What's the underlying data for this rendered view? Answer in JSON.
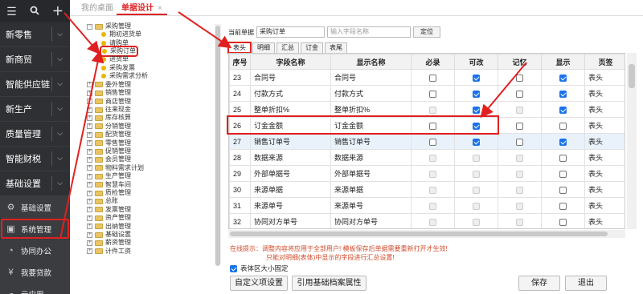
{
  "sidebar": {
    "top_icons": [
      "menu-icon",
      "search-icon",
      "plus-icon"
    ],
    "main_items": [
      {
        "label": "新零售"
      },
      {
        "label": "新商贸"
      },
      {
        "label": "智能供应链"
      },
      {
        "label": "新生产"
      },
      {
        "label": "质量管理"
      },
      {
        "label": "智能财税"
      },
      {
        "label": "基础设置"
      }
    ],
    "sub_items": [
      {
        "label": "基础设置",
        "icon": "gear-icon"
      },
      {
        "label": "系统管理",
        "icon": "monitor-icon"
      },
      {
        "label": "协同办公",
        "icon": "chat-icon"
      },
      {
        "label": "我要贷款",
        "icon": "money-icon"
      },
      {
        "label": "云应用",
        "icon": "cloud-icon"
      }
    ]
  },
  "tabs": {
    "desk": "我的桌面",
    "design": "单据设计",
    "close": "×"
  },
  "tree": {
    "items": [
      {
        "label": "采购管理",
        "kind": "folder"
      },
      {
        "label": "期初进货单",
        "kind": "leaf"
      },
      {
        "label": "请购单",
        "kind": "leaf"
      },
      {
        "label": "采购订单",
        "kind": "leaf"
      },
      {
        "label": "进货单",
        "kind": "leaf"
      },
      {
        "label": "采购发票",
        "kind": "leaf"
      },
      {
        "label": "采购需求分析",
        "kind": "leaf"
      },
      {
        "label": "委外管理",
        "kind": "folder"
      },
      {
        "label": "销售管理",
        "kind": "folder"
      },
      {
        "label": "商店管理",
        "kind": "folder"
      },
      {
        "label": "往来现金",
        "kind": "folder"
      },
      {
        "label": "库存核算",
        "kind": "folder"
      },
      {
        "label": "分销管理",
        "kind": "folder"
      },
      {
        "label": "配货管理",
        "kind": "folder"
      },
      {
        "label": "零售管理",
        "kind": "folder"
      },
      {
        "label": "促销管理",
        "kind": "folder"
      },
      {
        "label": "会员管理",
        "kind": "folder"
      },
      {
        "label": "物料需求计划",
        "kind": "folder"
      },
      {
        "label": "生产管理",
        "kind": "folder"
      },
      {
        "label": "智慧车间",
        "kind": "folder"
      },
      {
        "label": "质检管理",
        "kind": "folder"
      },
      {
        "label": "总账",
        "kind": "folder"
      },
      {
        "label": "发票管理",
        "kind": "folder"
      },
      {
        "label": "资产管理",
        "kind": "folder"
      },
      {
        "label": "出纳管理",
        "kind": "folder"
      },
      {
        "label": "基础设置",
        "kind": "folder"
      },
      {
        "label": "薪资管理",
        "kind": "folder"
      },
      {
        "label": "计件工资",
        "kind": "folder"
      }
    ]
  },
  "form": {
    "current_label": "当前单据",
    "current_value": "采购订单",
    "field_placeholder": "输入字段名称",
    "locate_label": "定位"
  },
  "subtabs": [
    {
      "label": "表头"
    },
    {
      "label": "明细"
    },
    {
      "label": "汇总"
    },
    {
      "label": "订金"
    },
    {
      "label": "表尾"
    }
  ],
  "grid": {
    "headers": [
      "序号",
      "字段名称",
      "显示名称",
      "必录",
      "可改",
      "记忆",
      "显示",
      "页签"
    ],
    "rows": [
      {
        "seq": "23",
        "field": "合同号",
        "display": "合同号",
        "req": false,
        "edit": true,
        "mem": false,
        "show": true,
        "tab": "表头"
      },
      {
        "seq": "24",
        "field": "付款方式",
        "display": "付款方式",
        "req": false,
        "edit": true,
        "mem": false,
        "show": true,
        "tab": "表头"
      },
      {
        "seq": "25",
        "field": "整单折扣%",
        "display": "整单折扣%",
        "req": false,
        "edit": true,
        "mem": false,
        "show": true,
        "tab": "表头"
      },
      {
        "seq": "26",
        "field": "订金金额",
        "display": "订金金额",
        "req": false,
        "edit": true,
        "mem": false,
        "show": false,
        "tab": "表头"
      },
      {
        "seq": "27",
        "field": "销售订单号",
        "display": "销售订单号",
        "req": false,
        "edit": true,
        "mem": false,
        "show": true,
        "tab": "表头"
      },
      {
        "seq": "28",
        "field": "数据来源",
        "display": "数据来源",
        "req": false,
        "edit": false,
        "mem": false,
        "show": false,
        "tab": "表头"
      },
      {
        "seq": "29",
        "field": "外部单据号",
        "display": "外部单据号",
        "req": false,
        "edit": false,
        "mem": false,
        "show": false,
        "tab": "表头"
      },
      {
        "seq": "30",
        "field": "来源单据",
        "display": "来源单据",
        "req": false,
        "edit": false,
        "mem": false,
        "show": false,
        "tab": "表头"
      },
      {
        "seq": "31",
        "field": "来源单号",
        "display": "来源单号",
        "req": false,
        "edit": false,
        "mem": false,
        "show": false,
        "tab": "表头"
      },
      {
        "seq": "32",
        "field": "协同对方单号",
        "display": "协同对方单号",
        "req": false,
        "edit": false,
        "mem": false,
        "show": false,
        "tab": "表头"
      }
    ]
  },
  "hint": {
    "line1": "在线提示：调整内容将应用于全部用户! 模板保存后单据需要重新打开才生效!",
    "line2": "只能对明细(表体)中显示的字段进行汇总设置!"
  },
  "fix_label": "表体区大小固定",
  "buttons": {
    "custom": "自定义项设置",
    "quote": "引用基础档案属性",
    "save": "保存",
    "exit": "退出"
  },
  "colors": {
    "accent": "#e02020",
    "sidebar": "#2e3033",
    "checkbox": "#1a73e8"
  }
}
